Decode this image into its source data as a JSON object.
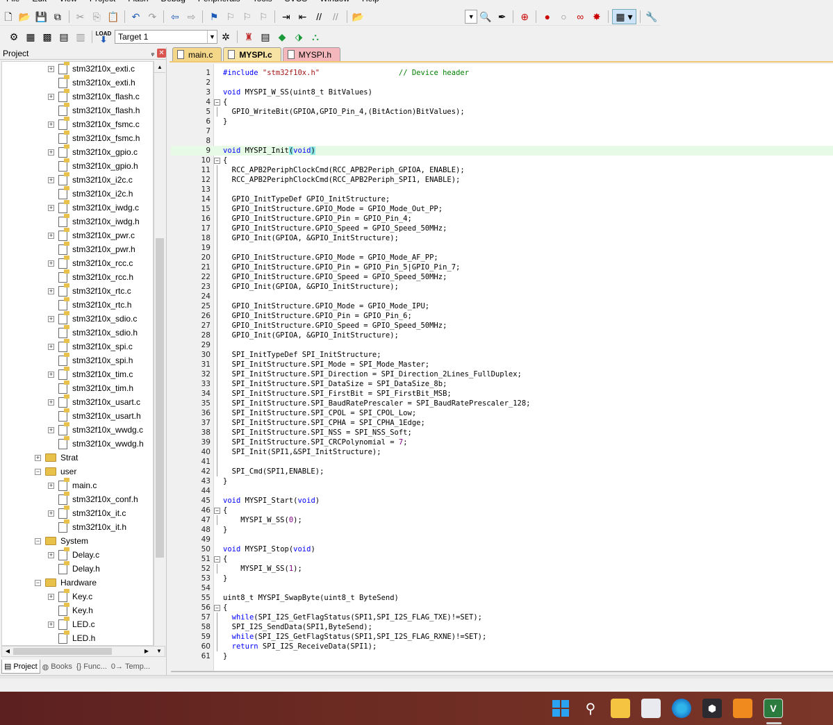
{
  "menubar": [
    "File",
    "Edit",
    "View",
    "Project",
    "Flash",
    "Debug",
    "Peripherals",
    "Tools",
    "SVCS",
    "Window",
    "Help"
  ],
  "toolbar2": {
    "target": "Target 1",
    "load_label": "LOAD"
  },
  "project_panel": {
    "title": "Project",
    "pin_glyph": "ᵩ",
    "close_glyph": "✕",
    "tree": [
      {
        "label": "stm32f10x_exti.c",
        "type": "file",
        "depth": 2,
        "expandable": true
      },
      {
        "label": "stm32f10x_exti.h",
        "type": "file",
        "depth": 2,
        "expandable": false
      },
      {
        "label": "stm32f10x_flash.c",
        "type": "file",
        "depth": 2,
        "expandable": true
      },
      {
        "label": "stm32f10x_flash.h",
        "type": "file",
        "depth": 2,
        "expandable": false
      },
      {
        "label": "stm32f10x_fsmc.c",
        "type": "file",
        "depth": 2,
        "expandable": true
      },
      {
        "label": "stm32f10x_fsmc.h",
        "type": "file",
        "depth": 2,
        "expandable": false
      },
      {
        "label": "stm32f10x_gpio.c",
        "type": "file",
        "depth": 2,
        "expandable": true
      },
      {
        "label": "stm32f10x_gpio.h",
        "type": "file",
        "depth": 2,
        "expandable": false
      },
      {
        "label": "stm32f10x_i2c.c",
        "type": "file",
        "depth": 2,
        "expandable": true
      },
      {
        "label": "stm32f10x_i2c.h",
        "type": "file",
        "depth": 2,
        "expandable": false
      },
      {
        "label": "stm32f10x_iwdg.c",
        "type": "file",
        "depth": 2,
        "expandable": true
      },
      {
        "label": "stm32f10x_iwdg.h",
        "type": "file",
        "depth": 2,
        "expandable": false
      },
      {
        "label": "stm32f10x_pwr.c",
        "type": "file",
        "depth": 2,
        "expandable": true
      },
      {
        "label": "stm32f10x_pwr.h",
        "type": "file",
        "depth": 2,
        "expandable": false
      },
      {
        "label": "stm32f10x_rcc.c",
        "type": "file",
        "depth": 2,
        "expandable": true
      },
      {
        "label": "stm32f10x_rcc.h",
        "type": "file",
        "depth": 2,
        "expandable": false
      },
      {
        "label": "stm32f10x_rtc.c",
        "type": "file",
        "depth": 2,
        "expandable": true
      },
      {
        "label": "stm32f10x_rtc.h",
        "type": "file",
        "depth": 2,
        "expandable": false
      },
      {
        "label": "stm32f10x_sdio.c",
        "type": "file",
        "depth": 2,
        "expandable": true
      },
      {
        "label": "stm32f10x_sdio.h",
        "type": "file",
        "depth": 2,
        "expandable": false
      },
      {
        "label": "stm32f10x_spi.c",
        "type": "file",
        "depth": 2,
        "expandable": true
      },
      {
        "label": "stm32f10x_spi.h",
        "type": "file",
        "depth": 2,
        "expandable": false
      },
      {
        "label": "stm32f10x_tim.c",
        "type": "file",
        "depth": 2,
        "expandable": true
      },
      {
        "label": "stm32f10x_tim.h",
        "type": "file",
        "depth": 2,
        "expandable": false
      },
      {
        "label": "stm32f10x_usart.c",
        "type": "file",
        "depth": 2,
        "expandable": true
      },
      {
        "label": "stm32f10x_usart.h",
        "type": "file",
        "depth": 2,
        "expandable": false
      },
      {
        "label": "stm32f10x_wwdg.c",
        "type": "file",
        "depth": 2,
        "expandable": true
      },
      {
        "label": "stm32f10x_wwdg.h",
        "type": "file",
        "depth": 2,
        "expandable": false
      },
      {
        "label": "Strat",
        "type": "folder",
        "depth": 1,
        "expandable": true,
        "expander": "+"
      },
      {
        "label": "user",
        "type": "folder",
        "depth": 1,
        "expandable": true,
        "expander": "−"
      },
      {
        "label": "main.c",
        "type": "file",
        "depth": 2,
        "expandable": true
      },
      {
        "label": "stm32f10x_conf.h",
        "type": "file",
        "depth": 2,
        "expandable": false
      },
      {
        "label": "stm32f10x_it.c",
        "type": "file",
        "depth": 2,
        "expandable": true
      },
      {
        "label": "stm32f10x_it.h",
        "type": "file",
        "depth": 2,
        "expandable": false
      },
      {
        "label": "System",
        "type": "folder",
        "depth": 1,
        "expandable": true,
        "expander": "−"
      },
      {
        "label": "Delay.c",
        "type": "file",
        "depth": 2,
        "expandable": true
      },
      {
        "label": "Delay.h",
        "type": "file",
        "depth": 2,
        "expandable": false
      },
      {
        "label": "Hardware",
        "type": "folder",
        "depth": 1,
        "expandable": true,
        "expander": "−"
      },
      {
        "label": "Key.c",
        "type": "file",
        "depth": 2,
        "expandable": true
      },
      {
        "label": "Key.h",
        "type": "file",
        "depth": 2,
        "expandable": false
      },
      {
        "label": "LED.c",
        "type": "file",
        "depth": 2,
        "expandable": true
      },
      {
        "label": "LED.h",
        "type": "file",
        "depth": 2,
        "expandable": false
      }
    ],
    "bottom_tabs": [
      {
        "label": "Project",
        "icon": "▤"
      },
      {
        "label": "Books",
        "icon": "◍"
      },
      {
        "label": "Func...",
        "icon": "{}"
      },
      {
        "label": "Temp...",
        "icon": "0→"
      }
    ]
  },
  "editor": {
    "tabs": [
      "main.c",
      "MYSPI.c",
      "MYSPI.h"
    ],
    "active_tab": "MYSPI.c",
    "current_line": 9,
    "lines": [
      {
        "n": "1",
        "t": "#include \"stm32f10x.h\"                  // Device header",
        "fold": ""
      },
      {
        "n": "2",
        "t": "",
        "fold": ""
      },
      {
        "n": "3",
        "t": "void MYSPI_W_SS(uint8_t BitValues)",
        "fold": ""
      },
      {
        "n": "4",
        "t": "{",
        "fold": "box"
      },
      {
        "n": "5",
        "t": "  GPIO_WriteBit(GPIOA,GPIO_Pin_4,(BitAction)BitValues);",
        "fold": "line"
      },
      {
        "n": "6",
        "t": "}",
        "fold": ""
      },
      {
        "n": "7",
        "t": "",
        "fold": ""
      },
      {
        "n": "8",
        "t": "",
        "fold": ""
      },
      {
        "n": "9",
        "t": "void MYSPI_Init(void)",
        "fold": ""
      },
      {
        "n": "10",
        "t": "{",
        "fold": "box"
      },
      {
        "n": "11",
        "t": "  RCC_APB2PeriphClockCmd(RCC_APB2Periph_GPIOA, ENABLE);",
        "fold": "line"
      },
      {
        "n": "12",
        "t": "  RCC_APB2PeriphClockCmd(RCC_APB2Periph_SPI1, ENABLE);",
        "fold": "line"
      },
      {
        "n": "13",
        "t": "",
        "fold": "line"
      },
      {
        "n": "14",
        "t": "  GPIO_InitTypeDef GPIO_InitStructure;",
        "fold": "line"
      },
      {
        "n": "15",
        "t": "  GPIO_InitStructure.GPIO_Mode = GPIO_Mode_Out_PP;",
        "fold": "line"
      },
      {
        "n": "16",
        "t": "  GPIO_InitStructure.GPIO_Pin = GPIO_Pin_4;",
        "fold": "line"
      },
      {
        "n": "17",
        "t": "  GPIO_InitStructure.GPIO_Speed = GPIO_Speed_50MHz;",
        "fold": "line"
      },
      {
        "n": "18",
        "t": "  GPIO_Init(GPIOA, &GPIO_InitStructure);",
        "fold": "line"
      },
      {
        "n": "19",
        "t": "",
        "fold": "line"
      },
      {
        "n": "20",
        "t": "  GPIO_InitStructure.GPIO_Mode = GPIO_Mode_AF_PP;",
        "fold": "line"
      },
      {
        "n": "21",
        "t": "  GPIO_InitStructure.GPIO_Pin = GPIO_Pin_5|GPIO_Pin_7;",
        "fold": "line"
      },
      {
        "n": "22",
        "t": "  GPIO_InitStructure.GPIO_Speed = GPIO_Speed_50MHz;",
        "fold": "line"
      },
      {
        "n": "23",
        "t": "  GPIO_Init(GPIOA, &GPIO_InitStructure);",
        "fold": "line"
      },
      {
        "n": "24",
        "t": "",
        "fold": "line"
      },
      {
        "n": "25",
        "t": "  GPIO_InitStructure.GPIO_Mode = GPIO_Mode_IPU;",
        "fold": "line"
      },
      {
        "n": "26",
        "t": "  GPIO_InitStructure.GPIO_Pin = GPIO_Pin_6;",
        "fold": "line"
      },
      {
        "n": "27",
        "t": "  GPIO_InitStructure.GPIO_Speed = GPIO_Speed_50MHz;",
        "fold": "line"
      },
      {
        "n": "28",
        "t": "  GPIO_Init(GPIOA, &GPIO_InitStructure);",
        "fold": "line"
      },
      {
        "n": "29",
        "t": "",
        "fold": "line"
      },
      {
        "n": "30",
        "t": "  SPI_InitTypeDef SPI_InitStructure;",
        "fold": "line"
      },
      {
        "n": "31",
        "t": "  SPI_InitStructure.SPI_Mode = SPI_Mode_Master;",
        "fold": "line"
      },
      {
        "n": "32",
        "t": "  SPI_InitStructure.SPI_Direction = SPI_Direction_2Lines_FullDuplex;",
        "fold": "line"
      },
      {
        "n": "33",
        "t": "  SPI_InitStructure.SPI_DataSize = SPI_DataSize_8b;",
        "fold": "line"
      },
      {
        "n": "34",
        "t": "  SPI_InitStructure.SPI_FirstBit = SPI_FirstBit_MSB;",
        "fold": "line"
      },
      {
        "n": "35",
        "t": "  SPI_InitStructure.SPI_BaudRatePrescaler = SPI_BaudRatePrescaler_128;",
        "fold": "line"
      },
      {
        "n": "36",
        "t": "  SPI_InitStructure.SPI_CPOL = SPI_CPOL_Low;",
        "fold": "line"
      },
      {
        "n": "37",
        "t": "  SPI_InitStructure.SPI_CPHA = SPI_CPHA_1Edge;",
        "fold": "line"
      },
      {
        "n": "38",
        "t": "  SPI_InitStructure.SPI_NSS = SPI_NSS_Soft;",
        "fold": "line"
      },
      {
        "n": "39",
        "t": "  SPI_InitStructure.SPI_CRCPolynomial = 7;",
        "fold": "line"
      },
      {
        "n": "40",
        "t": "  SPI_Init(SPI1,&SPI_InitStructure);",
        "fold": "line"
      },
      {
        "n": "41",
        "t": "",
        "fold": "line"
      },
      {
        "n": "42",
        "t": "  SPI_Cmd(SPI1,ENABLE);",
        "fold": "line"
      },
      {
        "n": "43",
        "t": "}",
        "fold": ""
      },
      {
        "n": "44",
        "t": "",
        "fold": ""
      },
      {
        "n": "45",
        "t": "void MYSPI_Start(void)",
        "fold": ""
      },
      {
        "n": "46",
        "t": "{",
        "fold": "box"
      },
      {
        "n": "47",
        "t": "    MYSPI_W_SS(0);",
        "fold": "line"
      },
      {
        "n": "48",
        "t": "}",
        "fold": ""
      },
      {
        "n": "49",
        "t": "",
        "fold": ""
      },
      {
        "n": "50",
        "t": "void MYSPI_Stop(void)",
        "fold": ""
      },
      {
        "n": "51",
        "t": "{",
        "fold": "box"
      },
      {
        "n": "52",
        "t": "    MYSPI_W_SS(1);",
        "fold": "line"
      },
      {
        "n": "53",
        "t": "}",
        "fold": ""
      },
      {
        "n": "54",
        "t": "",
        "fold": ""
      },
      {
        "n": "55",
        "t": "uint8_t MYSPI_SwapByte(uint8_t ByteSend)",
        "fold": ""
      },
      {
        "n": "56",
        "t": "{",
        "fold": "box"
      },
      {
        "n": "57",
        "t": "  while(SPI_I2S_GetFlagStatus(SPI1,SPI_I2S_FLAG_TXE)!=SET);",
        "fold": "line"
      },
      {
        "n": "58",
        "t": "  SPI_I2S_SendData(SPI1,ByteSend);",
        "fold": "line"
      },
      {
        "n": "59",
        "t": "  while(SPI_I2S_GetFlagStatus(SPI1,SPI_I2S_FLAG_RXNE)!=SET);",
        "fold": "line"
      },
      {
        "n": "60",
        "t": "  return SPI_I2S_ReceiveData(SPI1);",
        "fold": "line"
      },
      {
        "n": "61",
        "t": "}",
        "fold": ""
      }
    ]
  },
  "taskbar": {
    "apps": [
      "start-icon",
      "search-icon",
      "file-explorer-icon",
      "store-icon",
      "edge-icon",
      "cube-app-icon",
      "orange-app-icon",
      "keil-uvision-icon"
    ],
    "keil_glyph": "V"
  },
  "colors": {
    "keyword": "#0000ff",
    "string": "#a31515",
    "comment": "#008000",
    "current_line": "#e6fae6",
    "tab_active": "#f7e3a4"
  }
}
